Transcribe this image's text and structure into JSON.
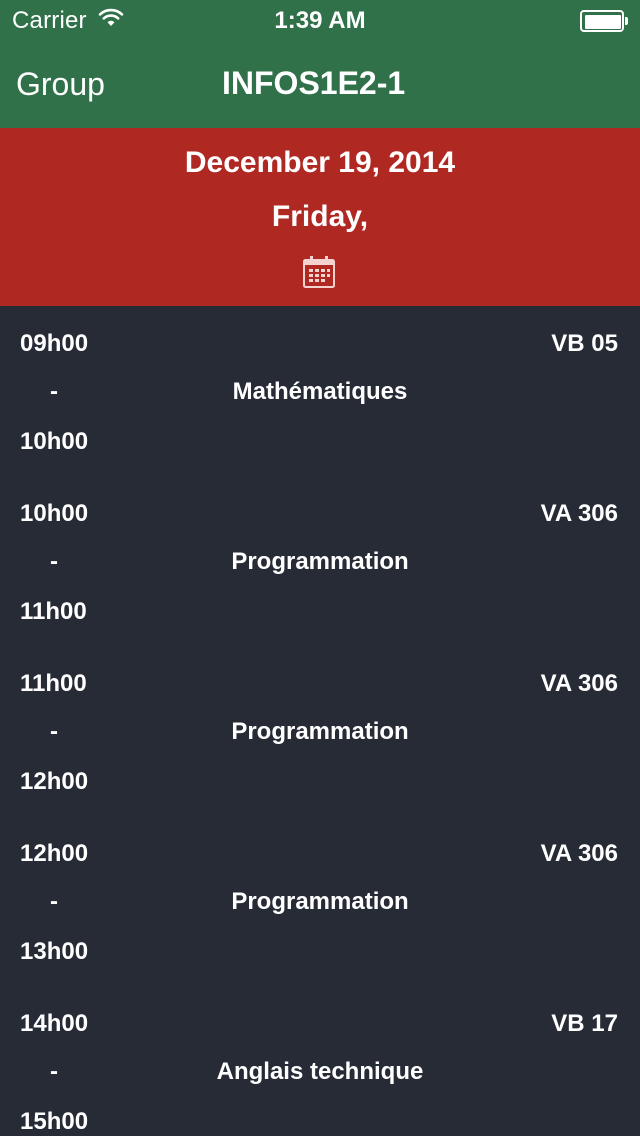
{
  "status_bar": {
    "carrier": "Carrier",
    "time": "1:39 AM",
    "wifi_icon": "wifi-icon",
    "battery_icon": "battery-icon"
  },
  "nav": {
    "back_label": "Group",
    "title": "INFOS1E2-1"
  },
  "date_banner": {
    "date": "December 19, 2014",
    "day": "Friday,",
    "calendar_icon": "calendar-icon"
  },
  "colors": {
    "nav_background": "#30714a",
    "date_banner_background": "#b02822",
    "list_background": "#262b36",
    "text": "#ffffff"
  },
  "sessions": [
    {
      "start": "09h00",
      "separator": "-",
      "end": "10h00",
      "room": "VB 05",
      "course": "Mathématiques"
    },
    {
      "start": "10h00",
      "separator": "-",
      "end": "11h00",
      "room": "VA 306",
      "course": "Programmation"
    },
    {
      "start": "11h00",
      "separator": "-",
      "end": "12h00",
      "room": "VA 306",
      "course": "Programmation"
    },
    {
      "start": "12h00",
      "separator": "-",
      "end": "13h00",
      "room": "VA 306",
      "course": "Programmation"
    },
    {
      "start": "14h00",
      "separator": "-",
      "end": "15h00",
      "room": "VB 17",
      "course": "Anglais technique"
    }
  ]
}
